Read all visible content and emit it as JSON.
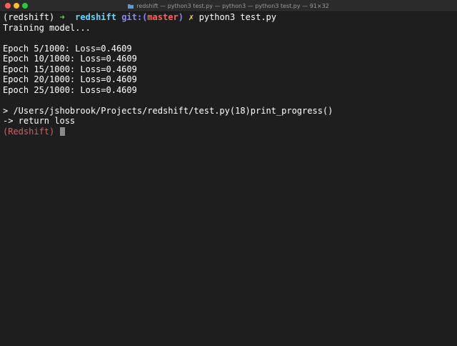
{
  "window": {
    "title": "redshift — python3 test.py — python3 — python3 test.py — 91×32",
    "folder_icon": "folder-icon"
  },
  "colors": {
    "background": "#1e1e1e",
    "titlebar": "#2b2b2b",
    "text": "#ffffff",
    "arrow": "#5fd75f",
    "dir": "#5fd7ff",
    "git_label": "#8787ff",
    "branch": "#ff5f5f",
    "dirty_marker": "#ffd75f",
    "debug_prompt": "#d75f5f",
    "cursor": "#8a8a8a",
    "traffic_close": "#ff5f57",
    "traffic_minimize": "#febc2e",
    "traffic_zoom": "#28c840"
  },
  "prompt": {
    "env": "(redshift)",
    "arrow": "➜",
    "dir": "redshift",
    "git_label": "git:(",
    "branch": "master",
    "git_close": ")",
    "dirty_marker": "✗",
    "command": "python3 test.py"
  },
  "output": {
    "training": "Training model...",
    "epochs": [
      "Epoch 5/1000: Loss=0.4609",
      "Epoch 10/1000: Loss=0.4609",
      "Epoch 15/1000: Loss=0.4609",
      "Epoch 20/1000: Loss=0.4609",
      "Epoch 25/1000: Loss=0.4609"
    ],
    "debug_location": "> /Users/jshobrook/Projects/redshift/test.py(18)print_progress()",
    "debug_line": "-> return loss",
    "debug_prompt": "(Redshift)"
  }
}
